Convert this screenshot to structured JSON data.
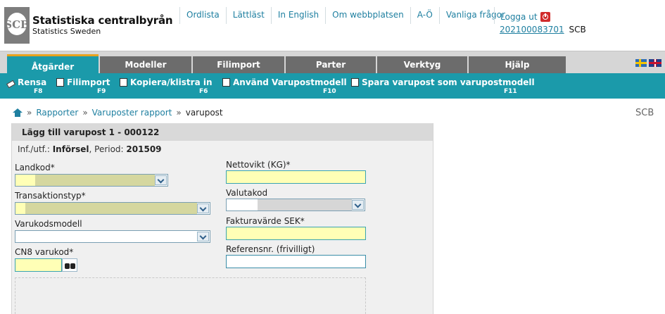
{
  "header": {
    "logo_title": "Statistiska centralbyrån",
    "logo_subtitle": "Statistics Sweden",
    "top_links": [
      "Ordlista",
      "Lättläst",
      "In English",
      "Om webbplatsen",
      "A-Ö",
      "Vanliga frågor"
    ],
    "logout_label": "Logga ut",
    "user_id": "202100083701",
    "user_org": "SCB"
  },
  "menu": {
    "items": [
      "Åtgärder",
      "Modeller",
      "Filimport",
      "Parter",
      "Verktyg",
      "Hjälp"
    ],
    "active": "Åtgärder"
  },
  "toolbar": {
    "items": [
      {
        "label": "Rensa",
        "key": "F8"
      },
      {
        "label": "Filimport",
        "key": "F9"
      },
      {
        "label": "Kopiera/klistra in",
        "key": "F6"
      },
      {
        "label": "Använd Varupostmodell",
        "key": "F10"
      },
      {
        "label": "Spara varupost som varupostmodell",
        "key": "F11"
      }
    ]
  },
  "breadcrumb": {
    "items": [
      "Rapporter",
      "Varuposter rapport"
    ],
    "current": "varupost",
    "separator": "»",
    "right_label": "SCB"
  },
  "panel": {
    "title": "Lägg till varupost 1 - 000122",
    "info_prefix": "Inf./utf.:",
    "info_flow": "Införsel",
    "info_period_label": ", Period:",
    "info_period": "201509"
  },
  "form": {
    "landkod_label": "Landkod*",
    "landkod_value": "",
    "transaktionstyp_label": "Transaktionstyp*",
    "transaktionstyp_value": "",
    "varukodsmodell_label": "Varukodsmodell",
    "varukodsmodell_value": "",
    "cn8_label": "CN8 varukod*",
    "cn8_value": "",
    "nettovikt_label": "Nettovikt (KG)*",
    "nettovikt_value": "",
    "valutakod_label": "Valutakod",
    "valutakod_value": "",
    "fakturavarde_label": "Fakturavärde SEK*",
    "fakturavarde_value": "",
    "referensnr_label": "Referensnr. (frivilligt)",
    "referensnr_value": ""
  },
  "colors": {
    "teal": "#1b9aaa",
    "menu_gray": "#6c6c6c",
    "active_border": "#e8a21f",
    "link_blue": "#1e7fa0",
    "required_yellow": "#ffffb6"
  }
}
